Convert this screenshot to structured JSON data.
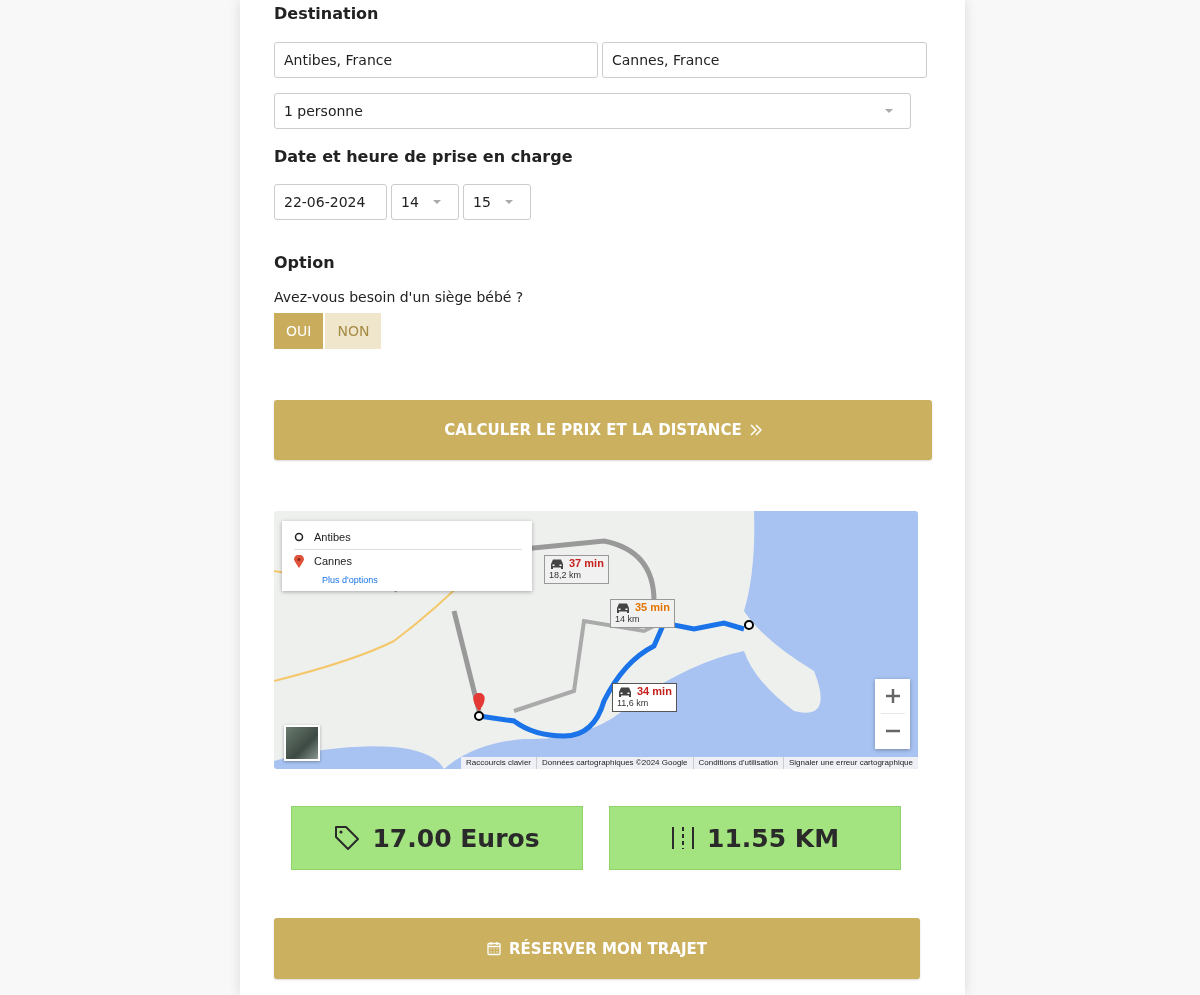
{
  "destination": {
    "title": "Destination",
    "from": "Antibes, France",
    "to": "Cannes, France",
    "passengers": "1 personne"
  },
  "pickup": {
    "title": "Date et heure de prise en charge",
    "date": "22-06-2024",
    "hour": "14",
    "minute": "15"
  },
  "option": {
    "title": "Option",
    "question": "Avez-vous besoin d'un siège bébé ?",
    "choices": [
      {
        "label": "OUI",
        "selected": true
      },
      {
        "label": "NON",
        "selected": false
      }
    ]
  },
  "calculate_button": {
    "label": "CALCULER LE PRIX ET LA DISTANCE"
  },
  "map": {
    "directions": [
      {
        "kind": "origin",
        "label": "Antibes"
      },
      {
        "kind": "destination",
        "label": "Cannes"
      }
    ],
    "more_options": "Plus d'options",
    "routes": [
      {
        "time": "37 min",
        "distance": "18,2 km",
        "color": "#c5221f",
        "selected": false
      },
      {
        "time": "35 min",
        "distance": "14 km",
        "color": "#e37400",
        "selected": false
      },
      {
        "time": "34 min",
        "distance": "11,6 km",
        "color": "#c5221f",
        "selected": true
      }
    ],
    "attribution": [
      "Raccourcis clavier",
      "Données cartographiques ©2024 Google",
      "Conditions d'utilisation",
      "Signaler une erreur cartographique"
    ]
  },
  "results": [
    {
      "kind": "price",
      "value": "17.00 Euros"
    },
    {
      "kind": "distance",
      "value": "11.55 KM"
    }
  ],
  "book_button": {
    "label": "RÉSERVER MON TRAJET"
  }
}
